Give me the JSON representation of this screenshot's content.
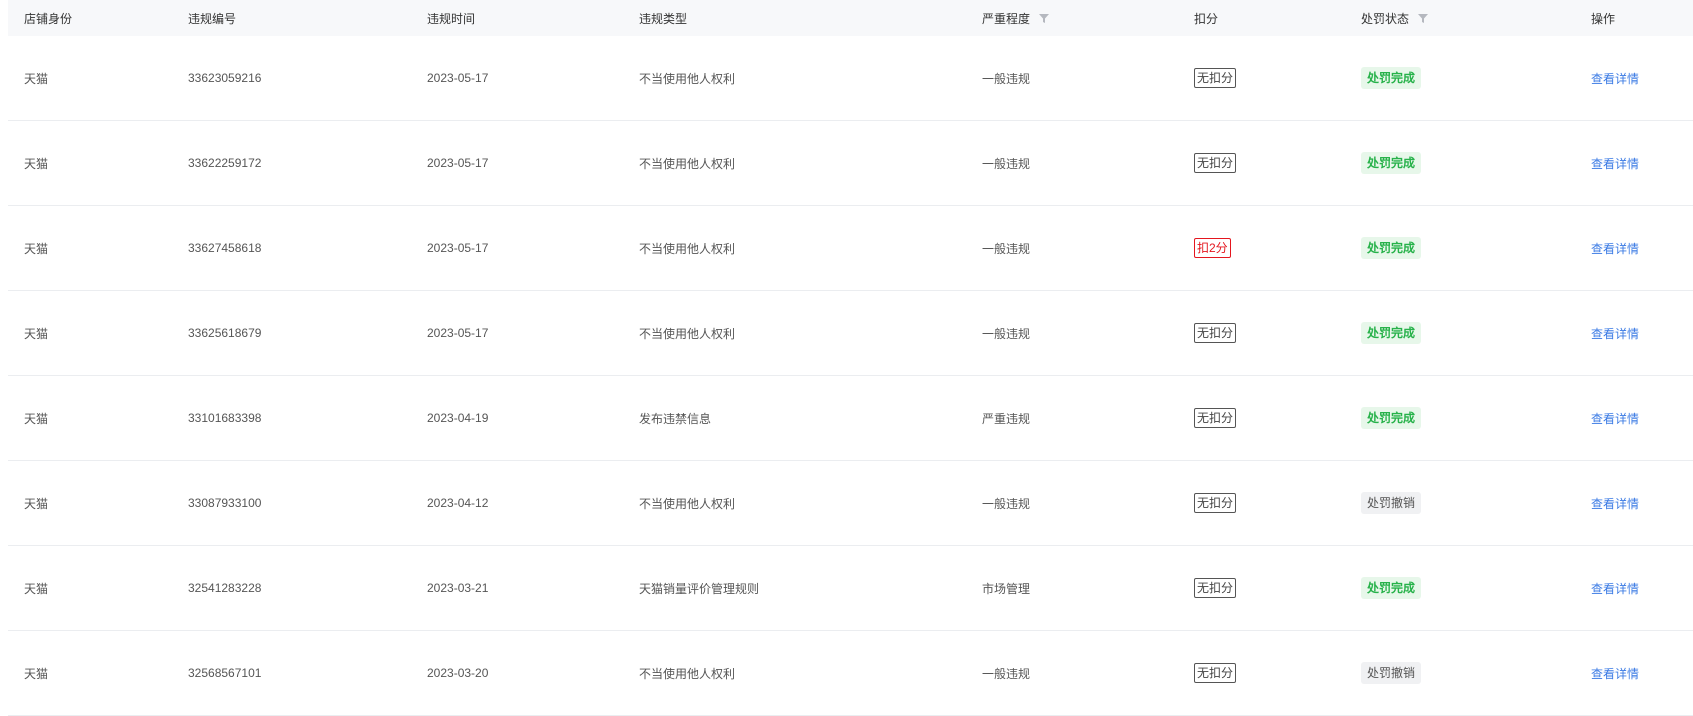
{
  "columns": {
    "shop_identity": "店铺身份",
    "violation_no": "违规编号",
    "violation_time": "违规时间",
    "violation_type": "违规类型",
    "severity": "严重程度",
    "deduction": "扣分",
    "penalty_status": "处罚状态",
    "action": "操作"
  },
  "icons": {
    "severity_filter": "filter-icon",
    "status_filter": "filter-icon"
  },
  "colors": {
    "link": "#3a7ae4",
    "status_done_bg": "#e7f7ea",
    "status_done_text": "#27b24a",
    "deduct_red": "#e4161e"
  },
  "rows": [
    {
      "shop": "天猫",
      "no": "33623059216",
      "time": "2023-05-17",
      "type": "不当使用他人权利",
      "severity": "一般违规",
      "deduction": "无扣分",
      "deduction_style": "normal",
      "status": "处罚完成",
      "status_style": "done",
      "action": "查看详情"
    },
    {
      "shop": "天猫",
      "no": "33622259172",
      "time": "2023-05-17",
      "type": "不当使用他人权利",
      "severity": "一般违规",
      "deduction": "无扣分",
      "deduction_style": "normal",
      "status": "处罚完成",
      "status_style": "done",
      "action": "查看详情"
    },
    {
      "shop": "天猫",
      "no": "33627458618",
      "time": "2023-05-17",
      "type": "不当使用他人权利",
      "severity": "一般违规",
      "deduction": "扣2分",
      "deduction_style": "red",
      "status": "处罚完成",
      "status_style": "done",
      "action": "查看详情"
    },
    {
      "shop": "天猫",
      "no": "33625618679",
      "time": "2023-05-17",
      "type": "不当使用他人权利",
      "severity": "一般违规",
      "deduction": "无扣分",
      "deduction_style": "normal",
      "status": "处罚完成",
      "status_style": "done",
      "action": "查看详情"
    },
    {
      "shop": "天猫",
      "no": "33101683398",
      "time": "2023-04-19",
      "type": "发布违禁信息",
      "severity": "严重违规",
      "deduction": "无扣分",
      "deduction_style": "normal",
      "status": "处罚完成",
      "status_style": "done",
      "action": "查看详情"
    },
    {
      "shop": "天猫",
      "no": "33087933100",
      "time": "2023-04-12",
      "type": "不当使用他人权利",
      "severity": "一般违规",
      "deduction": "无扣分",
      "deduction_style": "normal",
      "status": "处罚撤销",
      "status_style": "revoked",
      "action": "查看详情"
    },
    {
      "shop": "天猫",
      "no": "32541283228",
      "time": "2023-03-21",
      "type": "天猫销量评价管理规则",
      "severity": "市场管理",
      "deduction": "无扣分",
      "deduction_style": "normal",
      "status": "处罚完成",
      "status_style": "done",
      "action": "查看详情"
    },
    {
      "shop": "天猫",
      "no": "32568567101",
      "time": "2023-03-20",
      "type": "不当使用他人权利",
      "severity": "一般违规",
      "deduction": "无扣分",
      "deduction_style": "normal",
      "status": "处罚撤销",
      "status_style": "revoked",
      "action": "查看详情"
    }
  ]
}
